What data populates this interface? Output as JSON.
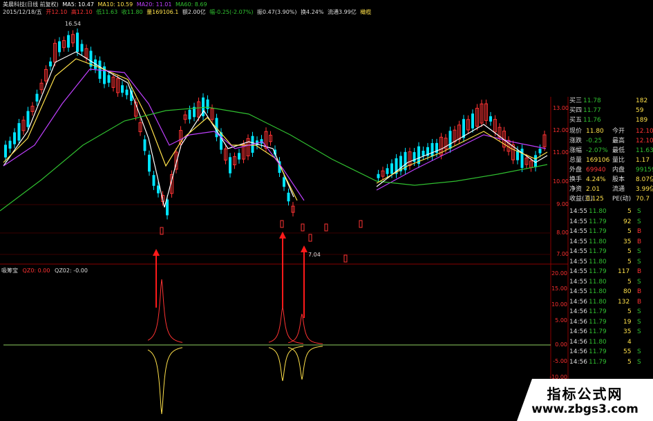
{
  "header": {
    "title": "美晨科技(日线 前复权)",
    "ma5": "MA5: 10.47",
    "ma10": "MA10: 10.59",
    "ma20": "MA20: 11.01",
    "ma60": "MA60: 8.69",
    "date": "2015/12/18/五",
    "open": "开12.10",
    "high": "高12.10",
    "low": "低11.63",
    "close": "收11.80",
    "volume": "量169106.1",
    "amount": "额2.00亿",
    "change": "幅-0.25(-2.07%)",
    "amplitude": "振0.47(3.90%)",
    "turnover": "换4.24%",
    "float_cap": "流通3.99亿",
    "extra": "橄榄"
  },
  "chart_annotations": {
    "high_label": "16.54",
    "low_label": "7.04"
  },
  "price_axis": [
    "13.00",
    "12.00",
    "11.00",
    "10.00",
    "9.00",
    "8.00",
    "7.00"
  ],
  "indicator": {
    "name": "吸筹宝",
    "qz0": "QZ0: 0.00",
    "qz02": "QZ02: -0.00",
    "axis": [
      "20.00",
      "15.00",
      "10.00",
      "5.00",
      "0.00",
      "-5.00",
      "-10.00"
    ]
  },
  "colors": {
    "up": "#ff3333",
    "down": "#00e5ff",
    "ma5": "#ffffff",
    "ma10": "#ffe14a",
    "ma20": "#c040ff",
    "ma60": "#30c030",
    "panel_grid": "#7a0000"
  },
  "quote": {
    "bid_rows": [
      {
        "label": "买三",
        "price": "11.78",
        "vol": "182"
      },
      {
        "label": "买四",
        "price": "11.77",
        "vol": "59"
      },
      {
        "label": "买五",
        "price": "11.76",
        "vol": "189"
      }
    ],
    "stats": [
      {
        "l1": "现价",
        "v1": "11.80",
        "l2": "今开",
        "v2": "12.10"
      },
      {
        "l1": "涨跌",
        "v1": "-0.25",
        "l2": "最高",
        "v2": "12.10"
      },
      {
        "l1": "涨幅",
        "v1": "-2.07%",
        "l2": "最低",
        "v2": "11.63"
      },
      {
        "l1": "总量",
        "v1": "169106",
        "l2": "量比",
        "v2": "1.17"
      },
      {
        "l1": "外盘",
        "v1": "69940",
        "l2": "内盘",
        "v2": "99159"
      },
      {
        "l1": "换手",
        "v1": "4.24%",
        "l2": "股本",
        "v2": "8.07亿"
      },
      {
        "l1": "净资",
        "v1": "2.01",
        "l2": "流通",
        "v2": "3.99亿"
      },
      {
        "l1": "收益(三)",
        "v1": "0.125",
        "l2": "PE(动)",
        "v2": "70.7"
      }
    ],
    "ticks": [
      {
        "t": "14:55",
        "p": "11.80",
        "v": "5",
        "d": "S"
      },
      {
        "t": "14:55",
        "p": "11.79",
        "v": "92",
        "d": "S"
      },
      {
        "t": "14:55",
        "p": "11.79",
        "v": "5",
        "d": "B"
      },
      {
        "t": "14:55",
        "p": "11.80",
        "v": "35",
        "d": "B"
      },
      {
        "t": "14:55",
        "p": "11.79",
        "v": "5",
        "d": "S"
      },
      {
        "t": "14:55",
        "p": "11.80",
        "v": "5",
        "d": "S"
      },
      {
        "t": "14:55",
        "p": "11.79",
        "v": "117",
        "d": "B"
      },
      {
        "t": "14:55",
        "p": "11.80",
        "v": "5",
        "d": "S"
      },
      {
        "t": "14:55",
        "p": "11.80",
        "v": "80",
        "d": "B"
      },
      {
        "t": "14:56",
        "p": "11.80",
        "v": "132",
        "d": "B"
      },
      {
        "t": "14:56",
        "p": "11.79",
        "v": "5",
        "d": "S"
      },
      {
        "t": "14:56",
        "p": "11.79",
        "v": "19",
        "d": "S"
      },
      {
        "t": "14:56",
        "p": "11.79",
        "v": "35",
        "d": "S"
      },
      {
        "t": "14:56",
        "p": "11.80",
        "v": "4",
        "d": ""
      },
      {
        "t": "14:56",
        "p": "11.79",
        "v": "55",
        "d": "S"
      },
      {
        "t": "14:56",
        "p": "11.79",
        "v": "5",
        "d": "S"
      }
    ]
  },
  "watermark": {
    "line1": "指标公式网",
    "line2": "www.zbgs3.com"
  }
}
